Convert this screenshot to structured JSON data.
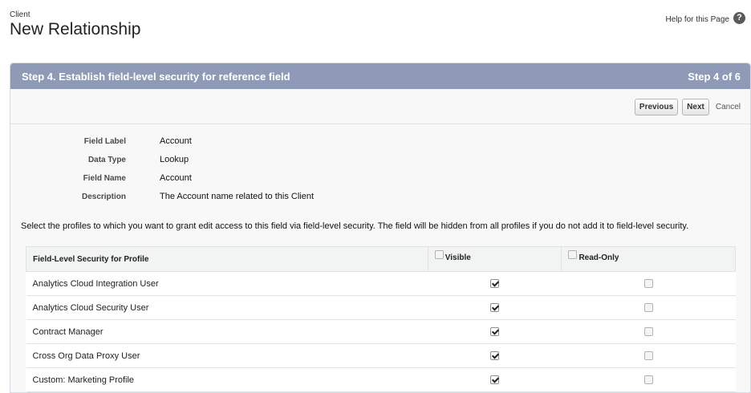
{
  "header": {
    "object_label": "Client",
    "title": "New Relationship",
    "help_link": "Help for this Page",
    "help_icon": "?"
  },
  "step": {
    "title": "Step 4. Establish field-level security for reference field",
    "counter": "Step 4 of 6"
  },
  "buttons": {
    "previous": "Previous",
    "next": "Next",
    "cancel": "Cancel"
  },
  "details": [
    {
      "label": "Field Label",
      "value": "Account"
    },
    {
      "label": "Data Type",
      "value": "Lookup"
    },
    {
      "label": "Field Name",
      "value": "Account"
    },
    {
      "label": "Description",
      "value": "The Account name related to this Client"
    }
  ],
  "instructions": "Select the profiles to which you want to grant edit access to this field via field-level security. The field will be hidden from all profiles if you do not add it to field-level security.",
  "table": {
    "columns": {
      "profile": "Field-Level Security for Profile",
      "visible": "Visible",
      "read_only": "Read-Only"
    },
    "rows": [
      {
        "profile": "Analytics Cloud Integration User",
        "visible": true,
        "read_only": false
      },
      {
        "profile": "Analytics Cloud Security User",
        "visible": true,
        "read_only": false
      },
      {
        "profile": "Contract Manager",
        "visible": true,
        "read_only": false
      },
      {
        "profile": "Cross Org Data Proxy User",
        "visible": true,
        "read_only": false
      },
      {
        "profile": "Custom: Marketing Profile",
        "visible": true,
        "read_only": false
      }
    ]
  },
  "colors": {
    "step_header_bg": "#8f9ab6",
    "page_bg": "#ffffff"
  }
}
